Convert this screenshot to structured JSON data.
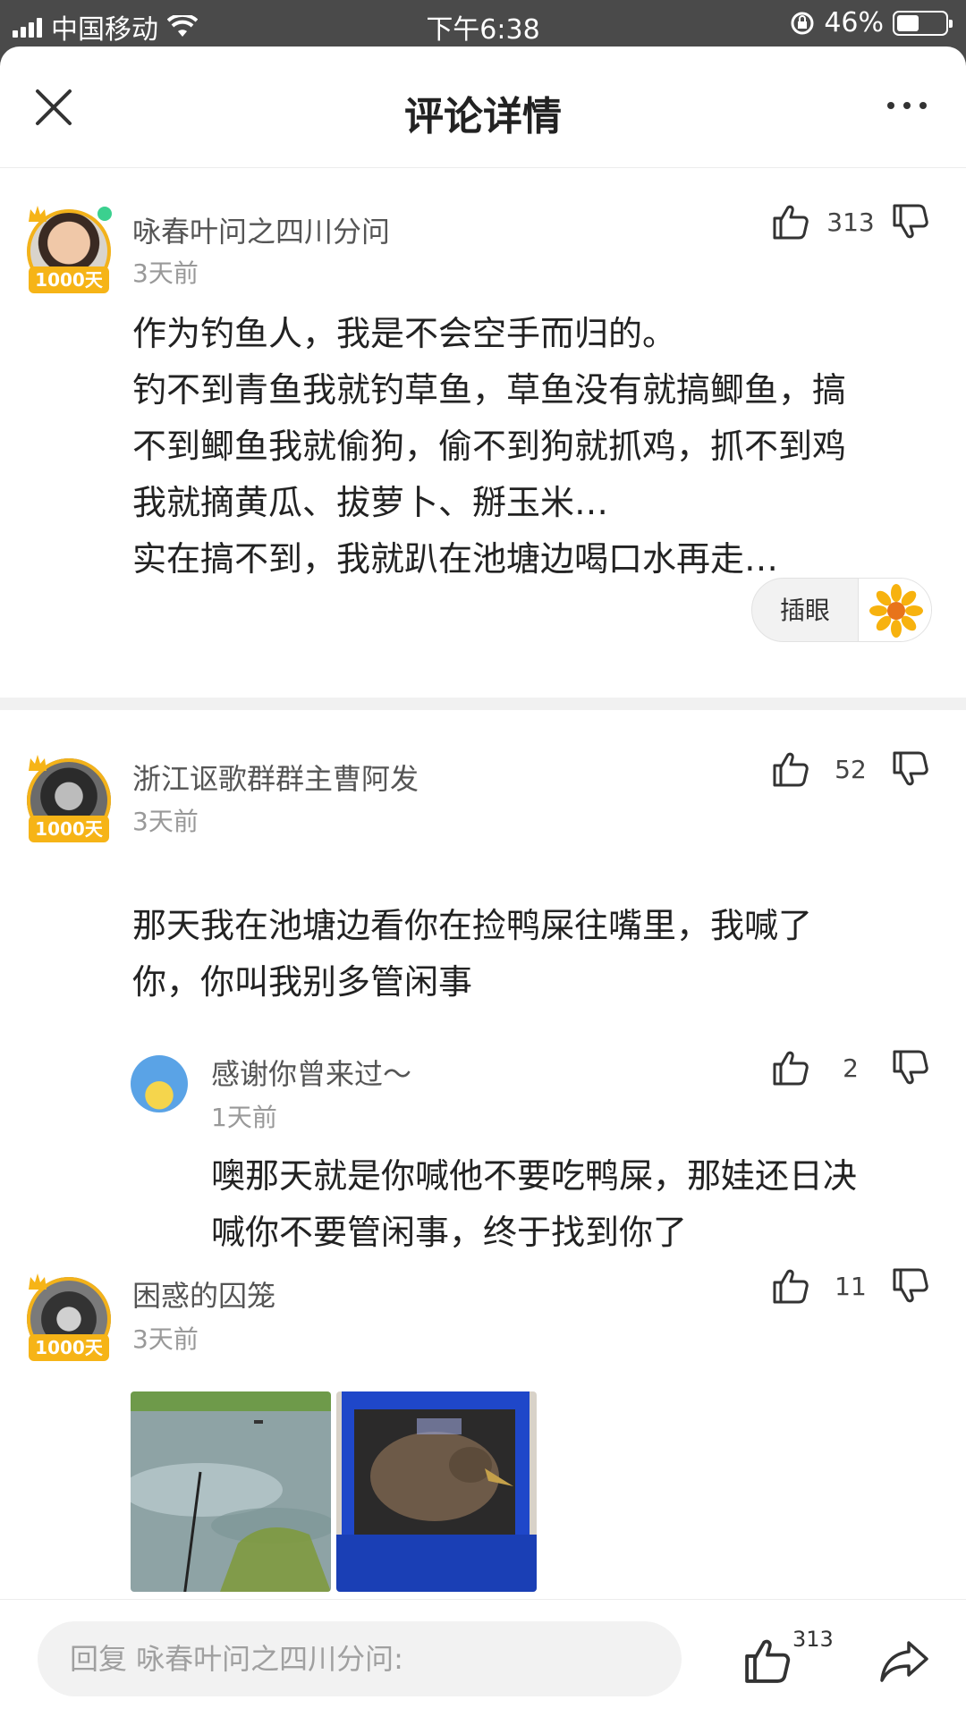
{
  "status_bar": {
    "carrier": "中国移动",
    "time": "下午6:38",
    "battery": "46%",
    "battery_level": 0.46
  },
  "header": {
    "title": "评论详情"
  },
  "comments": [
    {
      "username": "咏春叶问之四川分问",
      "time": "3天前",
      "likes": "313",
      "badge": "1000天",
      "content": [
        "作为钓鱼人，我是不会空手而归的。",
        "钓不到青鱼我就钓草鱼，草鱼没有就搞鲫鱼，搞",
        "不到鲫鱼我就偷狗，偷不到狗就抓鸡，抓不到鸡",
        "我就摘黄瓜、拔萝卜、掰玉米…",
        "实在搞不到，我就趴在池塘边喝口水再走…"
      ],
      "sticker_label": "插眼"
    },
    {
      "username": "浙江讴歌群群主曹阿发",
      "time": "3天前",
      "likes": "52",
      "badge": "1000天",
      "content": [
        "那天我在池塘边看你在捡鸭屎往嘴里，我喊了",
        "你，你叫我别多管闲事"
      ],
      "reply": {
        "username": "感谢你曾来过～",
        "time": "1天前",
        "likes": "2",
        "content": [
          "噢那天就是你喊他不要吃鸭屎，那娃还日决",
          "喊你不要管闲事，终于找到你了"
        ]
      }
    },
    {
      "username": "困惑的囚笼",
      "time": "3天前",
      "likes": "11",
      "badge": "1000天"
    }
  ],
  "bottom_bar": {
    "reply_placeholder": "回复 咏春叶问之四川分问:",
    "like_count": "313"
  },
  "colors": {
    "badge_gold": "#f6b417",
    "online_green": "#3bd08f",
    "reply_avatar_blue": "#5aa3e6"
  }
}
